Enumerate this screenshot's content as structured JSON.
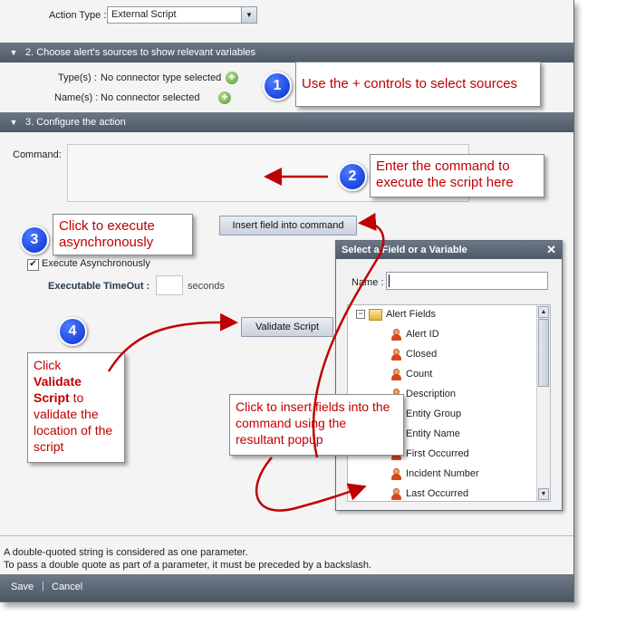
{
  "action_type": {
    "label": "Action Type :",
    "value": "External Script"
  },
  "section2": {
    "title": "2. Choose alert's sources to show relevant variables",
    "types_label": "Type(s) :",
    "types_value": "No connector type selected",
    "names_label": "Name(s) :",
    "names_value": "No connector selected"
  },
  "section3": {
    "title": "3. Configure the action",
    "command_label": "Command:"
  },
  "insert_button": "Insert field into command",
  "execute_async": {
    "label": "Execute Asynchronously",
    "checked": true
  },
  "timeout": {
    "label": "Executable TimeOut :",
    "unit": "seconds",
    "value": ""
  },
  "validate_button": "Validate Script",
  "popup": {
    "title": "Select a Field or a Variable",
    "name_label": "Name :",
    "name_value": "",
    "tree_root": "Alert Fields",
    "fields": [
      "Alert ID",
      "Closed",
      "Count",
      "Description",
      "Entity Group",
      "Entity Name",
      "First Occurred",
      "Incident Number",
      "Last Occurred"
    ]
  },
  "footer": {
    "note_line1": "A double-quoted string is considered as one parameter.",
    "note_line2": "To pass a double quote as part of a parameter, it must be preceded by a backslash.",
    "save": "Save",
    "separator": "|",
    "cancel": "Cancel"
  },
  "callouts": {
    "c1": {
      "badge": "1",
      "text": "Use the + controls to select sources"
    },
    "c2": {
      "badge": "2",
      "text": "Enter the command to execute the script here"
    },
    "c3": {
      "badge": "3",
      "text": "Click to execute asynchronously"
    },
    "c4": {
      "badge": "4",
      "text_before": "Click",
      "text_bold": "Validate Script",
      "text_after": "to validate the location of the script"
    },
    "c5": {
      "text": "Click to insert fields into the command using the resultant popup"
    }
  },
  "colors": {
    "callout_text": "#c00000",
    "badge": "#0b2fd0",
    "section_bar": "#56616f",
    "arrow": "#c00000"
  }
}
